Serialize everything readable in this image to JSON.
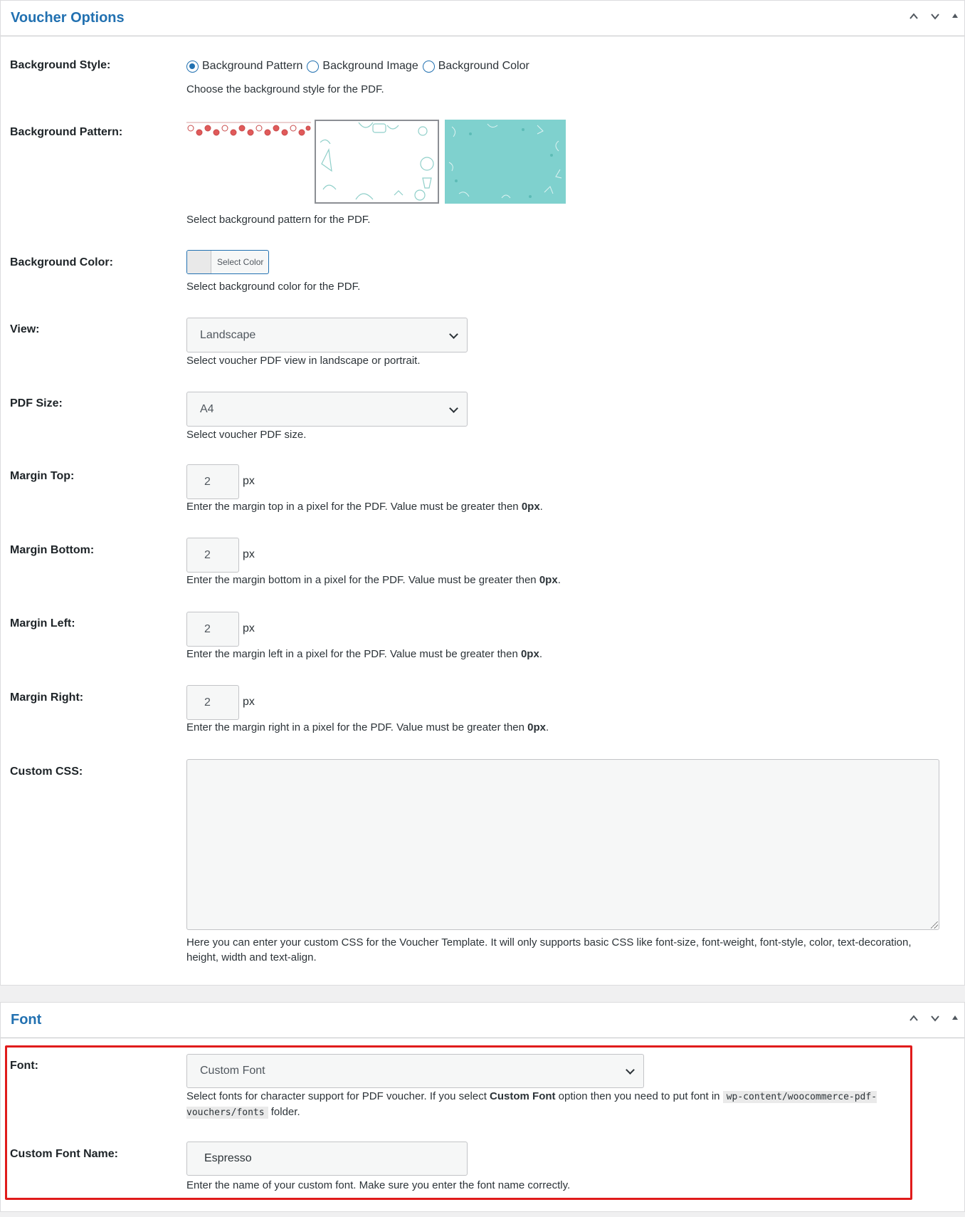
{
  "voucher_panel": {
    "title": "Voucher Options",
    "controls": {
      "up": "˄",
      "down": "˅",
      "toggle": "▲"
    },
    "background_style": {
      "label": "Background Style:",
      "options": [
        "Background Pattern",
        "Background Image",
        "Background Color"
      ],
      "selected": "Background Pattern",
      "description": "Choose the background style for the PDF."
    },
    "background_pattern": {
      "label": "Background Pattern:",
      "patterns": [
        "christmas-ornaments-pattern",
        "outline-doodle-pattern",
        "teal-leaf-pattern"
      ],
      "selected": "outline-doodle-pattern",
      "description": "Select background pattern for the PDF."
    },
    "background_color": {
      "label": "Background Color:",
      "button_label": "Select Color",
      "description": "Select background color for the PDF."
    },
    "view": {
      "label": "View:",
      "value": "Landscape",
      "description": "Select voucher PDF view in landscape or portrait."
    },
    "pdf_size": {
      "label": "PDF Size:",
      "value": "A4",
      "description": "Select voucher PDF size."
    },
    "margin_top": {
      "label": "Margin Top:",
      "value": "2",
      "unit": "px",
      "description": "Enter the margin top in a pixel for the PDF. Value must be greater then ",
      "description_bold": "0px",
      "description_end": "."
    },
    "margin_bottom": {
      "label": "Margin Bottom:",
      "value": "2",
      "unit": "px",
      "description": "Enter the margin bottom in a pixel for the PDF. Value must be greater then ",
      "description_bold": "0px",
      "description_end": "."
    },
    "margin_left": {
      "label": "Margin Left:",
      "value": "2",
      "unit": "px",
      "description": "Enter the margin left in a pixel for the PDF. Value must be greater then ",
      "description_bold": "0px",
      "description_end": "."
    },
    "margin_right": {
      "label": "Margin Right:",
      "value": "2",
      "unit": "px",
      "description": "Enter the margin right in a pixel for the PDF. Value must be greater then ",
      "description_bold": "0px",
      "description_end": "."
    },
    "custom_css": {
      "label": "Custom CSS:",
      "value": "",
      "description": "Here you can enter your custom CSS for the Voucher Template. It will only supports basic CSS like font-size, font-weight, font-style, color, text-decoration, height, width and text-align."
    }
  },
  "font_panel": {
    "title": "Font",
    "controls": {
      "up": "˄",
      "down": "˅",
      "toggle": "▲"
    },
    "font": {
      "label": "Font:",
      "value": "Custom Font",
      "description_start": "Select fonts for character support for PDF voucher. If you select ",
      "description_bold": "Custom Font",
      "description_mid": " option then you need to put font in ",
      "description_code": "wp-content/woocommerce-pdf-vouchers/fonts",
      "description_end": " folder."
    },
    "custom_font_name": {
      "label": "Custom Font Name:",
      "value": "Espresso",
      "description": "Enter the name of your custom font. Make sure you enter the font name correctly."
    }
  },
  "colors": {
    "accent": "#2271b1",
    "highlight_border": "#e01b1b",
    "teal_pattern": "#7fd1ce"
  }
}
